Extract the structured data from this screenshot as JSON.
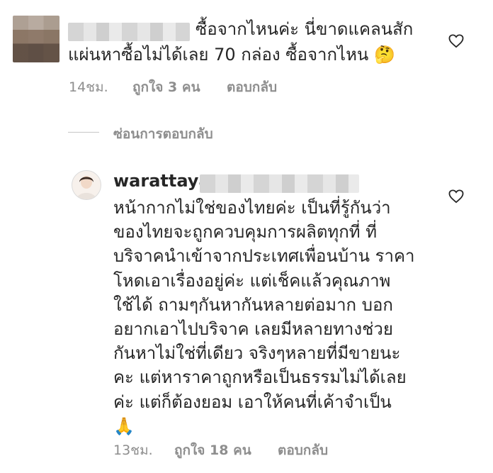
{
  "comment1": {
    "avatar_icon": "blurred-avatar",
    "text_line1": "ซื้อจากไหนค่ะ นี่ขาดแคลนสัก",
    "text_line2": "แผ่นหาซื้อไม่ได้เลย 70 กล่อง ซื้อจากไหน",
    "emoji": "🤔",
    "time": "14ชม.",
    "likes": "ถูกใจ 3 คน",
    "reply": "ตอบกลับ"
  },
  "hide_replies": "ซ่อนการตอบกลับ",
  "comment2": {
    "username": "warattaya",
    "lines": [
      "หน้ากากไม่ใช่ของไทยค่ะ เป็นที่รู้กันว่า",
      "ของไทยจะถูกควบคุมการผลิตทุกที่ ที่",
      "บริจาคนำเข้าจากประเทศเพื่อนบ้าน ราคา",
      "โหดเอาเรื่องอยู่ค่ะ แต่เช็คแล้วคุณภาพ",
      "ใช้ได้ ถามๆกันหากันหลายต่อมาก บอก",
      "อยากเอาไปบริจาค เลยมีหลายทางช่วย",
      "กันหาไม่ใช่ที่เดียว จริงๆหลายที่มีขายนะ",
      "คะ แต่หาราคาถูกหรือเป็นธรรมไม่ได้เลย",
      "ค่ะ แต่ก็ต้องยอม เอาให้คนที่เค้าจำเป็น"
    ],
    "emoji": "🙏",
    "time": "13ชม.",
    "likes": "ถูกใจ 18 คน",
    "reply": "ตอบกลับ"
  },
  "colors": {
    "text": "#262626",
    "meta": "#8e8e8e",
    "divider": "#c7c7c7"
  }
}
